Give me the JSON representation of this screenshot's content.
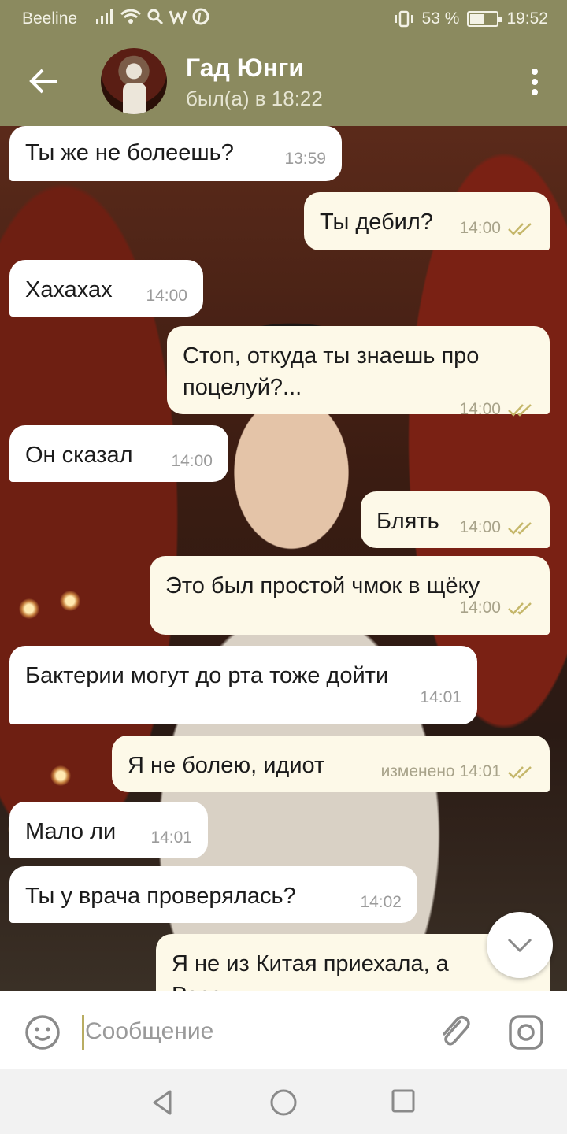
{
  "status_bar": {
    "carrier": "Beeline",
    "battery_text": "53 %",
    "battery_level": 0.53,
    "time": "19:52",
    "icons": [
      "signal-icon",
      "wifi-icon",
      "search-icon",
      "w-app-icon",
      "pinterest-icon",
      "vibrate-icon",
      "battery-icon"
    ]
  },
  "header": {
    "contact_name": "Гад Юнги",
    "contact_status": "был(а) в 18:22"
  },
  "messages": [
    {
      "side": "in",
      "text": "Ты же не болеешь?",
      "time": "13:59"
    },
    {
      "side": "out",
      "text": "Ты дебил?",
      "time": "14:00",
      "read": true
    },
    {
      "side": "in",
      "text": "Хахахах",
      "time": "14:00"
    },
    {
      "side": "out",
      "text": "Стоп, откуда ты знаешь про поцелуй?...",
      "time": "14:00",
      "read": true
    },
    {
      "side": "in",
      "text": "Он сказал",
      "time": "14:00"
    },
    {
      "side": "out",
      "text": "Блять",
      "time": "14:00",
      "read": true
    },
    {
      "side": "out",
      "text": "Это был простой чмок в щёку",
      "time": "14:00",
      "read": true
    },
    {
      "side": "in",
      "text": "Бактерии могут до рта тоже дойти",
      "time": "14:01"
    },
    {
      "side": "out",
      "text": "Я не болею, идиот",
      "time": "изменено 14:01",
      "read": true
    },
    {
      "side": "in",
      "text": "Мало ли",
      "time": "14:01"
    },
    {
      "side": "in",
      "text": "Ты у врача проверялась?",
      "time": "14:02"
    },
    {
      "side": "out",
      "text": "Я не из Китая приехала, а России",
      "time": ""
    }
  ],
  "input": {
    "placeholder": "Сообщение",
    "value": ""
  },
  "colors": {
    "header_bg": "#8b8a5f",
    "incoming_bubble": "#ffffff",
    "outgoing_bubble": "#fdf9e8",
    "check_color": "#c5b76a"
  }
}
